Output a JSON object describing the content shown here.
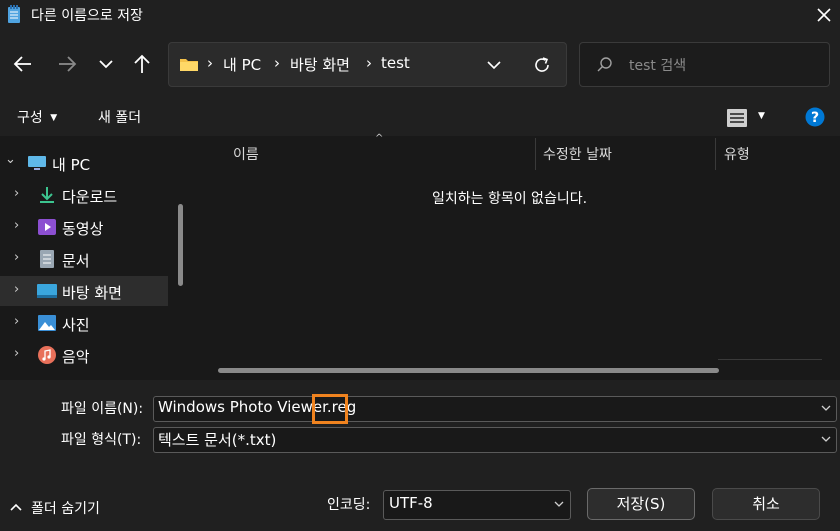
{
  "window": {
    "title": "다른 이름으로 저장"
  },
  "nav": {
    "breadcrumb": [
      "내 PC",
      "바탕 화면",
      "test"
    ],
    "search_placeholder": "test 검색"
  },
  "toolbar": {
    "organize_label": "구성",
    "new_folder_label": "새 폴더"
  },
  "sidebar": {
    "items": [
      {
        "label": "내 PC",
        "icon": "computer-icon",
        "expanded": true
      },
      {
        "label": "다운로드",
        "icon": "download-icon"
      },
      {
        "label": "동영상",
        "icon": "video-icon"
      },
      {
        "label": "문서",
        "icon": "document-icon"
      },
      {
        "label": "바탕 화면",
        "icon": "desktop-icon",
        "selected": true
      },
      {
        "label": "사진",
        "icon": "picture-icon"
      },
      {
        "label": "음악",
        "icon": "music-icon"
      }
    ]
  },
  "filelist": {
    "columns": [
      "이름",
      "수정한 날짜",
      "유형"
    ],
    "empty_message": "일치하는 항목이 없습니다."
  },
  "form": {
    "filename_label": "파일 이름(N):",
    "filename_value": "Windows Photo Viewer.reg",
    "filetype_label": "파일 형식(T):",
    "filetype_value": "텍스트 문서(*.txt)",
    "encoding_label": "인코딩:",
    "encoding_value": "UTF-8",
    "save_label": "저장(S)",
    "cancel_label": "취소",
    "hide_folders_label": "폴더 숨기기"
  },
  "colors": {
    "accent": "#0078d4",
    "highlight": "#f0831f",
    "background": "#191919"
  }
}
